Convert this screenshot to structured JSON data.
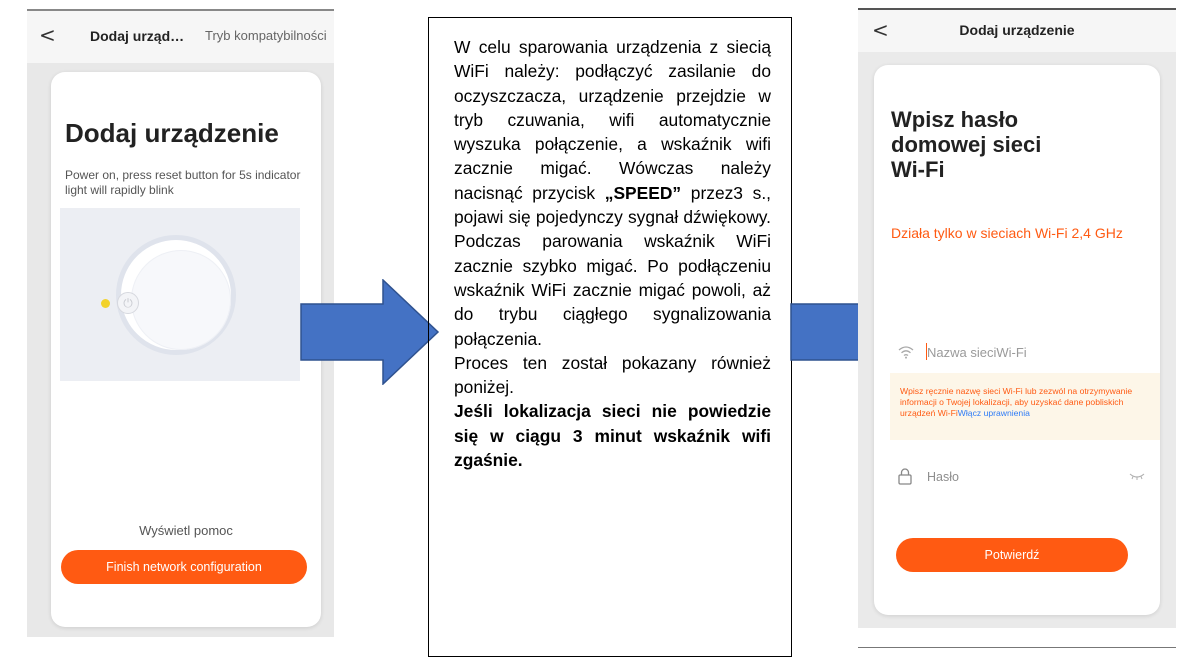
{
  "left_screen": {
    "back_glyph": "<",
    "title": "Dodaj urząd…",
    "compat_link": "Tryb kompatybilności",
    "heading": "Dodaj urządzenie",
    "instruction": "Power on, press reset button for 5s indicator light will rapidly blink",
    "power_glyph": "⏻",
    "help_link": "Wyświetl pomoc",
    "finish_button": "Finish network configuration",
    "accent_color": "#ff5a12",
    "led_color": "#f2d22b"
  },
  "arrow_color": "#4472c4",
  "instructions": {
    "p1": "W celu sparowania urządzenia z siecią WiFi należy: podłączyć zasilanie do oczyszczacza, urządzenie przejdzie w tryb czuwania, wifi automatycznie wyszuka połączenie, a wskaźnik wifi zacznie migać. Wówczas należy nacisnąć przycisk ",
    "p1_bold": "„SPEED”",
    "p1_rest": " przez3 s., pojawi się pojedynczy sygnał dźwiękowy. Podczas parowania wskaźnik WiFi zacznie szybko migać. Po podłączeniu wskaźnik WiFi zacznie migać powoli, aż do trybu ciągłego sygnalizowania połączenia.",
    "p2": "Proces ten został pokazany również poniżej.",
    "p3": "Jeśli lokalizacja sieci nie powiedzie się w ciągu 3 minut wskaźnik wifi zgaśnie."
  },
  "right_screen": {
    "back_glyph": "<",
    "title": "Dodaj urządzenie",
    "heading_line1": "Wpisz hasło",
    "heading_line2": "domowej sieci",
    "heading_line3": "Wi-Fi",
    "notice": "Działa tylko w sieciach Wi-Fi 2,4 GHz",
    "ssid_placeholder": "Nazwa sieciWi-Fi",
    "hint": "Wpisz ręcznie nazwę sieci Wi-Fi lub zezwól na otrzymywanie informacji o Twojej lokalizacji, aby uzyskać dane pobliskich urządzeń Wi-Fi",
    "hint_link": "Włącz uprawnienia",
    "password_placeholder": "Hasło",
    "confirm_button": "Potwierdź",
    "hint_bg_color": "#fdf6e8",
    "link_color": "#2f7cf6"
  }
}
